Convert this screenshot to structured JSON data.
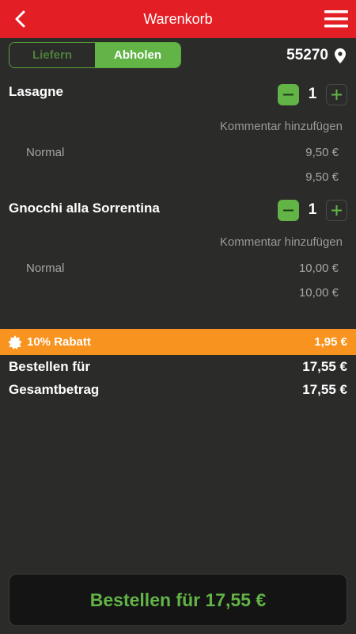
{
  "header": {
    "title": "Warenkorb",
    "back_icon": "chevron-left-icon",
    "menu_icon": "hamburger-menu-icon"
  },
  "mode": {
    "delivery_label": "Liefern",
    "pickup_label": "Abholen",
    "selected": "Abholen"
  },
  "location": {
    "zip": "55270",
    "icon": "map-pin-icon"
  },
  "cart": {
    "comment_label": "Kommentar hinzufügen",
    "items": [
      {
        "name": "Lasagne",
        "quantity": "1",
        "variant": "Normal",
        "variant_price": "9,50 €",
        "line_total": "9,50 €"
      },
      {
        "name": "Gnocchi alla Sorrentina",
        "quantity": "1",
        "variant": "Normal",
        "variant_price": "10,00 €",
        "line_total": "10,00 €"
      }
    ]
  },
  "discount": {
    "label": "10% Rabatt",
    "amount": "1,95 €",
    "icon": "badge-icon"
  },
  "summary": {
    "order_for_label": "Bestellen für",
    "order_for_value": "17,55 €",
    "total_label": "Gesamtbetrag",
    "total_value": "17,55 €"
  },
  "order_button": {
    "label": "Bestellen für 17,55 €"
  },
  "colors": {
    "header_red": "#e31e24",
    "accent_green": "#62b446",
    "discount_orange": "#f7931e",
    "background": "#2b2b2a"
  }
}
